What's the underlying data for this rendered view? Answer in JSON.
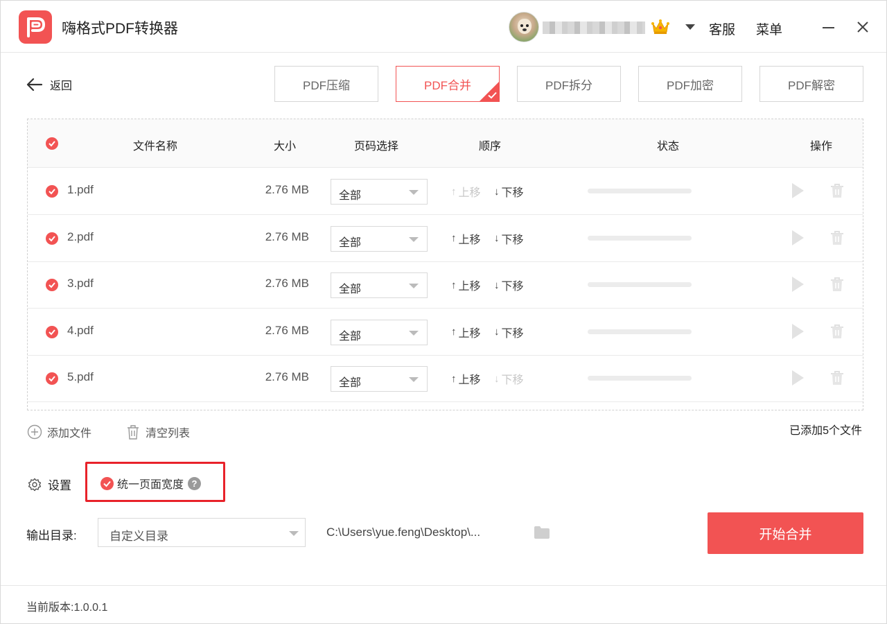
{
  "app": {
    "title": "嗨格式PDF转换器",
    "logo_icon": "pdf-p-logo-icon",
    "brand_color": "#f25353"
  },
  "header": {
    "username": "",
    "vip_icon": "crown-icon",
    "service_label": "客服",
    "menu_label": "菜单"
  },
  "nav": {
    "back_label": "返回"
  },
  "tabs": [
    {
      "label": "PDF压缩",
      "active": false
    },
    {
      "label": "PDF合并",
      "active": true
    },
    {
      "label": "PDF拆分",
      "active": false
    },
    {
      "label": "PDF加密",
      "active": false
    },
    {
      "label": "PDF解密",
      "active": false
    }
  ],
  "table": {
    "headers": {
      "name": "文件名称",
      "size": "大小",
      "pages": "页码选择",
      "order": "顺序",
      "status": "状态",
      "actions": "操作"
    },
    "move_up_label": "上移",
    "move_down_label": "下移",
    "rows": [
      {
        "name": "1.pdf",
        "size": "2.76 MB",
        "pages": "全部",
        "up_enabled": false,
        "down_enabled": true,
        "progress": 0
      },
      {
        "name": "2.pdf",
        "size": "2.76 MB",
        "pages": "全部",
        "up_enabled": true,
        "down_enabled": true,
        "progress": 0
      },
      {
        "name": "3.pdf",
        "size": "2.76 MB",
        "pages": "全部",
        "up_enabled": true,
        "down_enabled": true,
        "progress": 0
      },
      {
        "name": "4.pdf",
        "size": "2.76 MB",
        "pages": "全部",
        "up_enabled": true,
        "down_enabled": true,
        "progress": 0
      },
      {
        "name": "5.pdf",
        "size": "2.76 MB",
        "pages": "全部",
        "up_enabled": true,
        "down_enabled": false,
        "progress": 0
      }
    ]
  },
  "file_actions": {
    "add_label": "添加文件",
    "clear_label": "清空列表",
    "count_text": "已添加5个文件"
  },
  "settings": {
    "label": "设置",
    "uniform_width_label": "统一页面宽度",
    "uniform_width_checked": true,
    "help_glyph": "?"
  },
  "output": {
    "label": "输出目录:",
    "mode": "自定义目录",
    "path": "C:\\Users\\yue.feng\\Desktop\\...",
    "start_label": "开始合并"
  },
  "footer": {
    "version_text": "当前版本:1.0.0.1"
  }
}
